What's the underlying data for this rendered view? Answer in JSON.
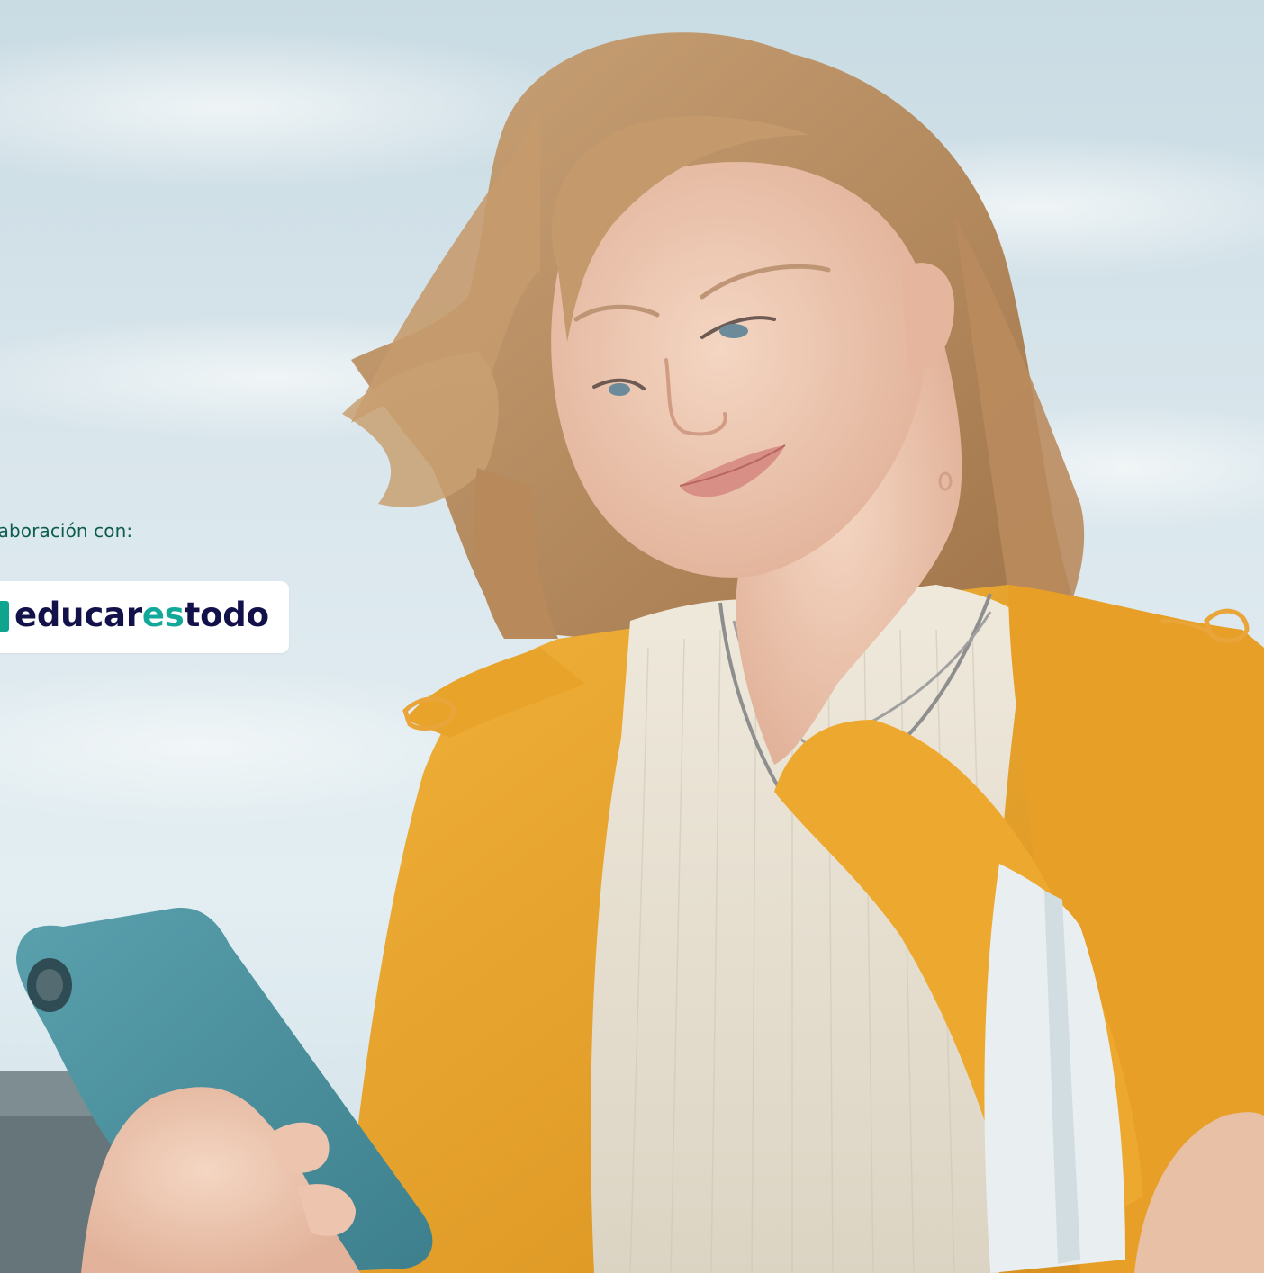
{
  "collaboration": {
    "text": "laboración con:"
  },
  "logo": {
    "part1": "educar",
    "part2": "es",
    "part3": "todo",
    "colors": {
      "dark": "#13114a",
      "accent": "#12a89a",
      "mark": "#0fa48e"
    }
  },
  "photo": {
    "subject": "young woman with blonde hair in a yellow jacket looking at a smartphone against a blue sky",
    "icon": "photo-background"
  },
  "colors": {
    "collab_text": "#0f5c4f",
    "sky": "#dfe9ee",
    "jacket": "#e8a32a",
    "phone": "#4f95a3"
  }
}
